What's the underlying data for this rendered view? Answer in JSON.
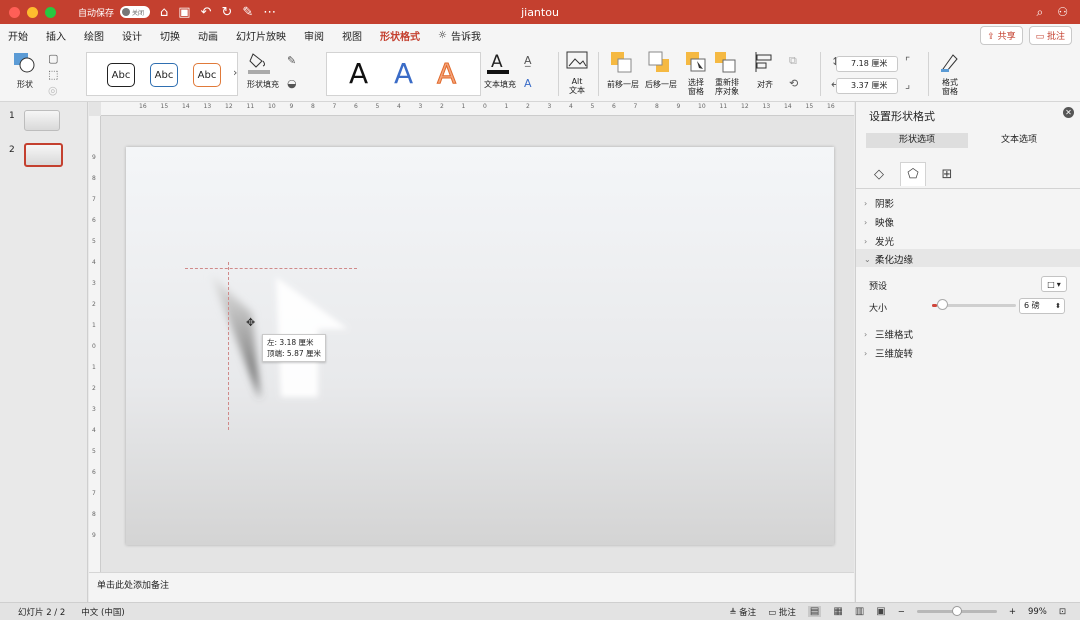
{
  "window": {
    "title": "jiantou",
    "autosave_label": "自动保存",
    "autosave_state": "关闭"
  },
  "menu": {
    "tabs": [
      "开始",
      "插入",
      "绘图",
      "设计",
      "切换",
      "动画",
      "幻灯片放映",
      "审阅",
      "视图",
      "形状格式"
    ],
    "active_tab": "形状格式",
    "tell_me": "告诉我",
    "share": "共享",
    "comments": "批注"
  },
  "ribbon": {
    "shapes_label": "形状",
    "style_samples": [
      "Abc",
      "Abc",
      "Abc"
    ],
    "shape_fill_label": "形状填充",
    "wordart_samples": [
      "A",
      "A",
      "A"
    ],
    "text_fill_label": "文本填充",
    "alt_text_label": [
      "Alt",
      "文本"
    ],
    "bring_forward": "前移一层",
    "send_backward": "后移一层",
    "selection_pane": [
      "选择",
      "窗格"
    ],
    "reorder": [
      "重新排",
      "序对象"
    ],
    "align": "对齐",
    "height": "7.18 厘米",
    "width": "3.37 厘米",
    "format_pane": [
      "格式",
      "窗格"
    ]
  },
  "thumbnails": [
    {
      "number": "1",
      "selected": false
    },
    {
      "number": "2",
      "selected": true
    }
  ],
  "ruler": {
    "top": [
      "16",
      "15",
      "14",
      "13",
      "12",
      "11",
      "10",
      "9",
      "8",
      "7",
      "6",
      "5",
      "4",
      "3",
      "2",
      "1",
      "0",
      "1",
      "2",
      "3",
      "4",
      "5",
      "6",
      "7",
      "8",
      "9",
      "10",
      "11",
      "12",
      "13",
      "14",
      "15",
      "16"
    ],
    "left": [
      "9",
      "8",
      "7",
      "6",
      "5",
      "4",
      "3",
      "2",
      "1",
      "0",
      "1",
      "2",
      "3",
      "4",
      "5",
      "6",
      "7",
      "8",
      "9"
    ]
  },
  "canvas": {
    "position_tip_left": "左: 3.18 厘米",
    "position_tip_top": "顶端: 5.87 厘米"
  },
  "notes_placeholder": "单击此处添加备注",
  "format_pane": {
    "title": "设置形状格式",
    "tabs": [
      "形状选项",
      "文本选项"
    ],
    "active_tab": "形状选项",
    "sections_before": [
      "阴影",
      "映像",
      "发光"
    ],
    "expanded_section": "柔化边缘",
    "preset_label": "预设",
    "size_label": "大小",
    "size_value": "6 磅",
    "size_slider_fraction": 0.06,
    "sections_after": [
      "三维格式",
      "三维旋转"
    ]
  },
  "status": {
    "slide_info": "幻灯片 2 / 2",
    "language": "中文 (中国)",
    "notes": "备注",
    "comments": "批注",
    "zoom": "99%",
    "zoom_fraction": 0.5
  },
  "colors": {
    "accent": "#c4402f",
    "slider_fill": "#d0453a"
  }
}
